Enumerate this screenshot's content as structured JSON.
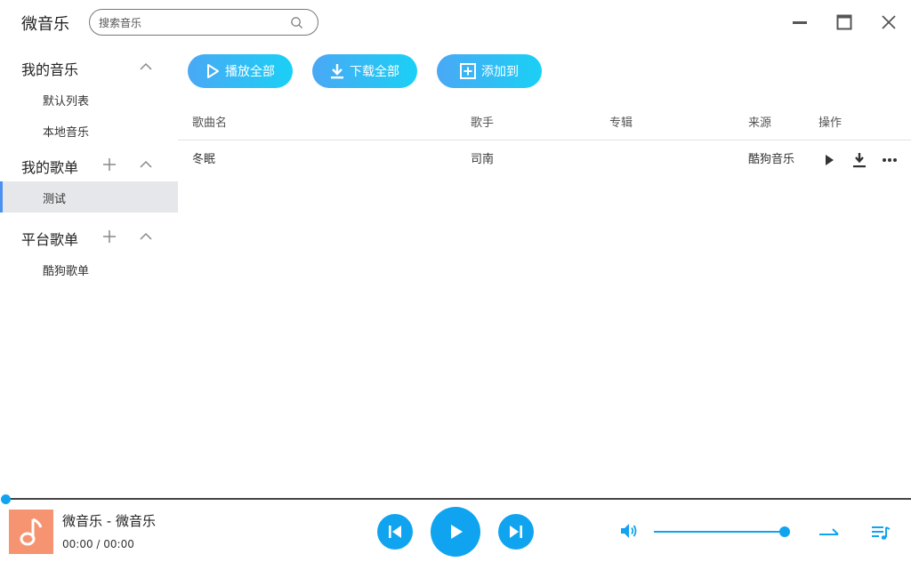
{
  "app": {
    "title": "微音乐"
  },
  "search": {
    "placeholder": "搜索音乐"
  },
  "sidebar": {
    "my_music": {
      "title": "我的音乐",
      "items": [
        "默认列表",
        "本地音乐"
      ]
    },
    "my_playlists": {
      "title": "我的歌单",
      "items": [
        "测试"
      ],
      "active": "测试"
    },
    "platform_playlists": {
      "title": "平台歌单",
      "items": [
        "酷狗歌单"
      ]
    }
  },
  "actions": {
    "play_all": "播放全部",
    "download_all": "下载全部",
    "add_to": "添加到"
  },
  "table": {
    "headers": {
      "song": "歌曲名",
      "artist": "歌手",
      "album": "专辑",
      "source": "来源",
      "ops": "操作"
    },
    "rows": [
      {
        "song": "冬眠",
        "artist": "司南",
        "album": "",
        "source": "酷狗音乐"
      }
    ]
  },
  "player": {
    "now_playing": "微音乐 - 微音乐",
    "time": "00:00 / 00:00",
    "progress": 0,
    "volume": 1.0
  },
  "colors": {
    "accent": "#10a4f0",
    "gradient_start": "#4aa8f5",
    "gradient_end": "#1ad0f5",
    "cover": "#f69472",
    "active_bar": "#4a90f0"
  },
  "icons": [
    "search-icon",
    "minimize-icon",
    "maximize-icon",
    "close-icon",
    "chevron-up-icon",
    "plus-icon",
    "play-icon",
    "download-icon",
    "add-box-icon",
    "more-icon",
    "prev-icon",
    "next-icon",
    "volume-icon",
    "play-mode-icon",
    "playlist-icon",
    "music-note-icon"
  ]
}
